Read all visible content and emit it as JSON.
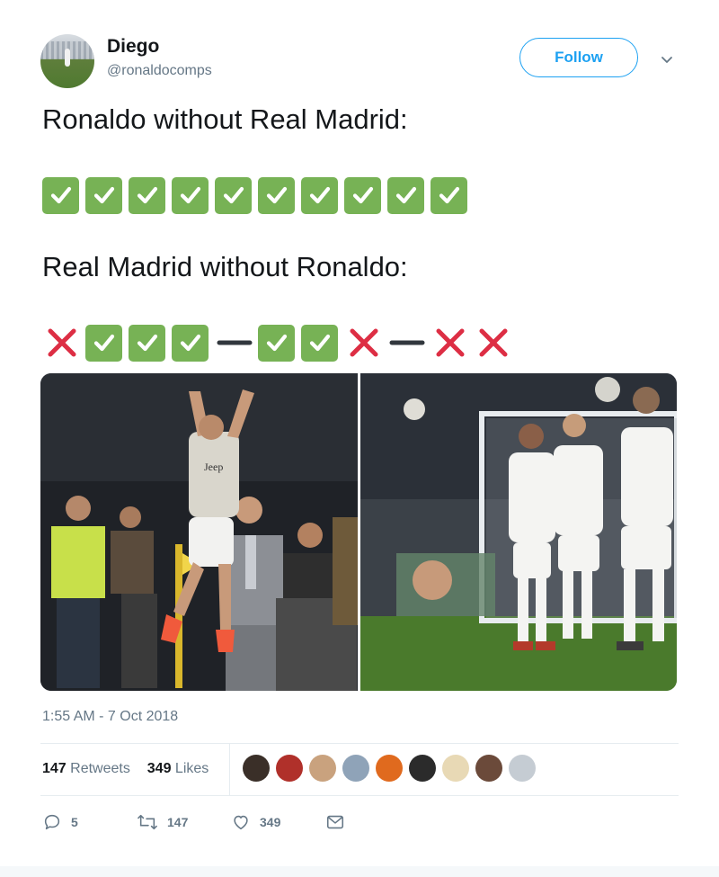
{
  "tweet": {
    "author_name": "Diego",
    "author_handle": "@ronaldocomps",
    "follow_label": "Follow",
    "line1": "Ronaldo without Real Madrid:",
    "line2": "Real Madrid without Ronaldo:",
    "row1_emojis": [
      "check",
      "check",
      "check",
      "check",
      "check",
      "check",
      "check",
      "check",
      "check",
      "check"
    ],
    "row2_emojis": [
      "cross",
      "check",
      "check",
      "check",
      "dash",
      "check",
      "check",
      "cross",
      "dash",
      "cross",
      "cross"
    ],
    "timestamp": "1:55 AM - 7 Oct 2018",
    "retweets_count": "147",
    "retweets_label": "Retweets",
    "likes_count": "349",
    "likes_label": "Likes",
    "liker_avatar_colors": [
      "#3a2f28",
      "#b0302a",
      "#c9a27e",
      "#8fa3b8",
      "#e06a1e",
      "#2b2b2b",
      "#e8d9b5",
      "#6b4a3a",
      "#c5ccd3"
    ]
  },
  "actions": {
    "reply_count": "5",
    "retweet_count": "147",
    "like_count": "349"
  },
  "colors": {
    "accent": "#1da1f2",
    "check_green": "#77b255",
    "cross_red": "#dd2e44"
  }
}
